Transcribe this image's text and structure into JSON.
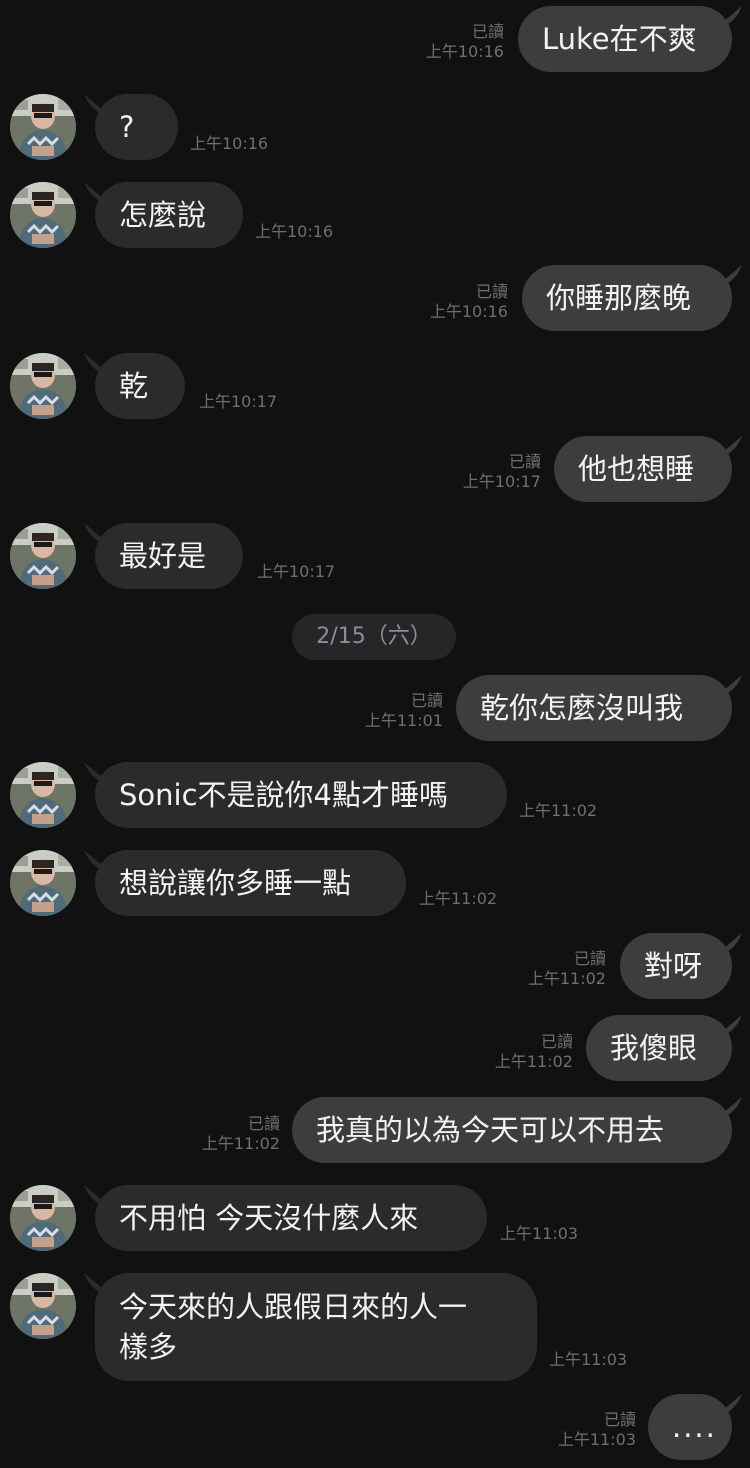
{
  "chat": {
    "date_divider": "2/15（六）",
    "read_label": "已讀",
    "messages": [
      {
        "dir": "out",
        "text": "Luke在不爽",
        "time": "上午10:16",
        "read": "已讀"
      },
      {
        "dir": "in",
        "text": "?",
        "time": "上午10:16"
      },
      {
        "dir": "in",
        "text": "怎麼說",
        "time": "上午10:16"
      },
      {
        "dir": "out",
        "text": "你睡那麼晚",
        "time": "上午10:16",
        "read": "已讀"
      },
      {
        "dir": "in",
        "text": "乾",
        "time": "上午10:17"
      },
      {
        "dir": "out",
        "text": "他也想睡",
        "time": "上午10:17",
        "read": "已讀"
      },
      {
        "dir": "in",
        "text": "最好是",
        "time": "上午10:17"
      },
      {
        "dir": "out",
        "text": "乾你怎麼沒叫我",
        "time": "上午11:01",
        "read": "已讀"
      },
      {
        "dir": "in",
        "text": "Sonic不是說你4點才睡嗎",
        "time": "上午11:02"
      },
      {
        "dir": "in",
        "text": "想說讓你多睡一點",
        "time": "上午11:02"
      },
      {
        "dir": "out",
        "text": "對呀",
        "time": "上午11:02",
        "read": "已讀"
      },
      {
        "dir": "out",
        "text": "我傻眼",
        "time": "上午11:02",
        "read": "已讀"
      },
      {
        "dir": "out",
        "text": "我真的以為今天可以不用去",
        "time": "上午11:02",
        "read": "已讀"
      },
      {
        "dir": "in",
        "text": "不用怕 今天沒什麼人來",
        "time": "上午11:03"
      },
      {
        "dir": "in",
        "line1": "今天來的人跟假日來的人一",
        "line2": "樣多",
        "time": "上午11:03"
      },
      {
        "dir": "out",
        "text": "....",
        "time": "上午11:03",
        "read": "已讀"
      }
    ]
  }
}
